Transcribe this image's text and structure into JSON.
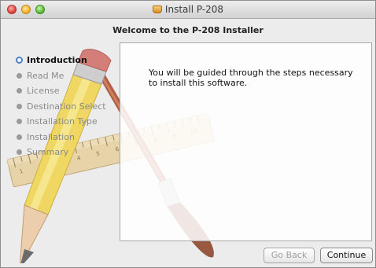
{
  "window": {
    "title": "Install P-208",
    "welcome": "Welcome to the P-208 Installer"
  },
  "steps": [
    {
      "label": "Introduction",
      "active": true
    },
    {
      "label": "Read Me",
      "active": false
    },
    {
      "label": "License",
      "active": false
    },
    {
      "label": "Destination Select",
      "active": false
    },
    {
      "label": "Installation Type",
      "active": false
    },
    {
      "label": "Installation",
      "active": false
    },
    {
      "label": "Summary",
      "active": false
    }
  ],
  "content": {
    "text": "You will be guided through the steps necessary to install this software."
  },
  "buttons": {
    "back": "Go Back",
    "continue": "Continue"
  },
  "ruler_marks": [
    "1",
    "2",
    "3",
    "4",
    "5",
    "6",
    "7",
    "8",
    "9",
    "10"
  ],
  "icons": {
    "title_icon": "installer-package-icon",
    "background_art": "pencil-ruler-brush-art"
  }
}
